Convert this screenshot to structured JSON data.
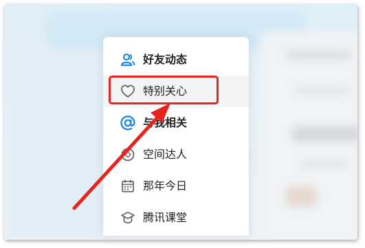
{
  "menu": {
    "items": [
      {
        "label": "好友动态",
        "icon": "friends-icon",
        "bold": true
      },
      {
        "label": "特别关心",
        "icon": "heart-icon",
        "bold": false
      },
      {
        "label": "与我相关",
        "icon": "at-icon",
        "bold": true
      },
      {
        "label": "空间达人",
        "icon": "badge-icon",
        "bold": false
      },
      {
        "label": "那年今日",
        "icon": "calendar-icon",
        "bold": false
      },
      {
        "label": "腾讯课堂",
        "icon": "graduation-cap-icon",
        "bold": false
      }
    ]
  },
  "colors": {
    "accent_blue": "#1e88e5",
    "annotation_red": "#e8231d",
    "icon_gray": "#666666"
  }
}
